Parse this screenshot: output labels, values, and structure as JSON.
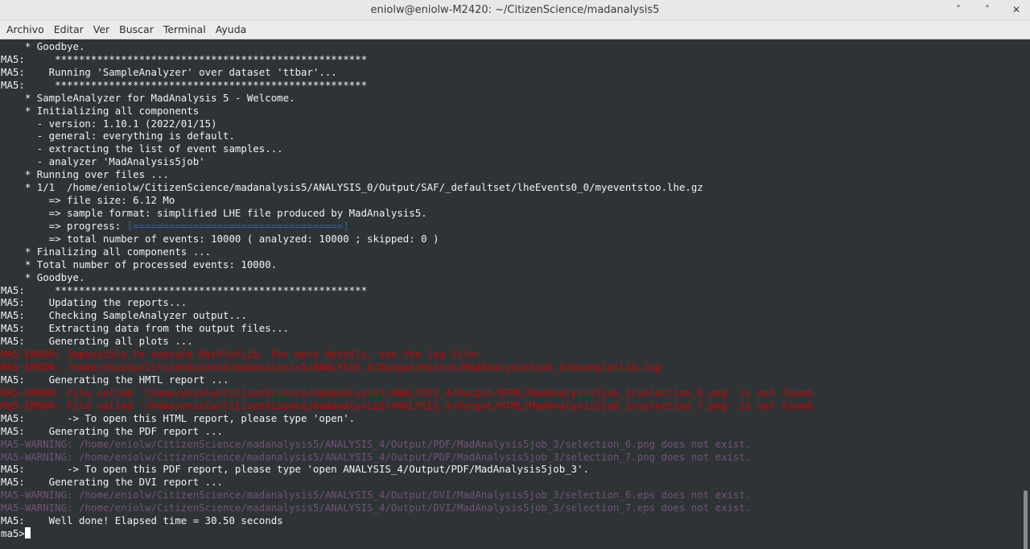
{
  "window": {
    "title": "eniolw@eniolw-M2420: ~/CitizenScience/madanalysis5",
    "minimize_glyph": "˅",
    "maximize_glyph": "˄",
    "close_glyph": "✕"
  },
  "menu": [
    "Archivo",
    "Editar",
    "Ver",
    "Buscar",
    "Terminal",
    "Ayuda"
  ],
  "colors": {
    "background": "#2e3436",
    "text": "#f2f2f2",
    "error": "#cc0000",
    "warning": "#75507b",
    "progress": "#3465a4"
  },
  "terminal": {
    "lines": [
      {
        "t": "    * Goodbye.",
        "c": "normal"
      },
      {
        "t": "MA5:     ****************************************************",
        "c": "normal"
      },
      {
        "t": "MA5:    Running 'SampleAnalyzer' over dataset 'ttbar'...",
        "c": "normal"
      },
      {
        "t": "MA5:     ****************************************************",
        "c": "normal"
      },
      {
        "t": "    * SampleAnalyzer for MadAnalysis 5 - Welcome.",
        "c": "normal"
      },
      {
        "t": "    * Initializing all components",
        "c": "normal"
      },
      {
        "t": "      - version: 1.10.1 (2022/01/15)",
        "c": "normal"
      },
      {
        "t": "      - general: everything is default.",
        "c": "normal"
      },
      {
        "t": "      - extracting the list of event samples...",
        "c": "normal"
      },
      {
        "t": "      - analyzer 'MadAnalysis5job'",
        "c": "normal"
      },
      {
        "t": "    * Running over files ...",
        "c": "normal"
      },
      {
        "t": "    * 1/1  /home/eniolw/CitizenScience/madanalysis5/ANALYSIS_0/Output/SAF/_defaultset/lheEvents0_0/myeventstoo.lhe.gz",
        "c": "normal"
      },
      {
        "t": "        => file size: 6.12 Mo",
        "c": "normal"
      },
      {
        "t": "        => sample format: simplified LHE file produced by MadAnalysis5.",
        "c": "normal"
      },
      {
        "t": "        => progress: ",
        "c": "normal",
        "extra": "[===================================]",
        "extra_c": "progress"
      },
      {
        "t": "        => total number of events: 10000 ( analyzed: 10000 ; skipped: 0 )",
        "c": "normal"
      },
      {
        "t": "    * Finalizing all components ...",
        "c": "normal"
      },
      {
        "t": "    * Total number of processed events: 10000.",
        "c": "normal"
      },
      {
        "t": "    * Goodbye.",
        "c": "normal"
      },
      {
        "t": "MA5:     ****************************************************",
        "c": "normal"
      },
      {
        "t": "MA5:    Updating the reports...",
        "c": "normal"
      },
      {
        "t": "MA5:    Checking SampleAnalyzer output...",
        "c": "normal"
      },
      {
        "t": "MA5:    Extracting data from the output files...",
        "c": "normal"
      },
      {
        "t": "MA5:    Generating all plots ...",
        "c": "normal"
      },
      {
        "t": "MA5-ERROR: Impossible to execute MatPlotLib. For more details, see the log file:",
        "c": "error"
      },
      {
        "t": "MA5-ERROR: /home/eniolw/CitizenScience/madanalysis5/ANALYSIS_4/Output/Histos/MadAnalysis5job_3/mcatplotlib.log",
        "c": "error"
      },
      {
        "t": "MA5:    Generating the HMTL report ...",
        "c": "normal"
      },
      {
        "t": "MA5-ERROR: File called '/home/eniolw/CitizenScience/madanalysis5/ANALYSIS_4/Output/HTML/MadAnalysis5job_3/selection_6.png' is not found.",
        "c": "error"
      },
      {
        "t": "MA5-ERROR: File called '/home/eniolw/CitizenScience/madanalysis5/ANALYSIS_4/Output/HTML/MadAnalysis5job_3/selection_7.png' is not found.",
        "c": "error"
      },
      {
        "t": "MA5:       -> To open this HTML report, please type 'open'.",
        "c": "normal"
      },
      {
        "t": "MA5:    Generating the PDF report ...",
        "c": "normal"
      },
      {
        "t": "MA5-WARNING: /home/eniolw/CitizenScience/madanalysis5/ANALYSIS_4/Output/PDF/MadAnalysis5job_3/selection_6.png does not exist.",
        "c": "warning"
      },
      {
        "t": "MA5-WARNING: /home/eniolw/CitizenScience/madanalysis5/ANALYSIS_4/Output/PDF/MadAnalysis5job_3/selection_7.png does not exist.",
        "c": "warning"
      },
      {
        "t": "MA5:       -> To open this PDF report, please type 'open ANALYSIS_4/Output/PDF/MadAnalysis5job_3'.",
        "c": "normal"
      },
      {
        "t": "MA5:    Generating the DVI report ...",
        "c": "normal"
      },
      {
        "t": "MA5-WARNING: /home/eniolw/CitizenScience/madanalysis5/ANALYSIS_4/Output/DVI/MadAnalysis5job_3/selection_6.eps does not exist.",
        "c": "warning"
      },
      {
        "t": "MA5-WARNING: /home/eniolw/CitizenScience/madanalysis5/ANALYSIS_4/Output/DVI/MadAnalysis5job_3/selection_7.eps does not exist.",
        "c": "warning"
      },
      {
        "t": "MA5:    Well done! Elapsed time = 30.50 seconds",
        "c": "normal"
      }
    ],
    "prompt": "ma5>"
  }
}
